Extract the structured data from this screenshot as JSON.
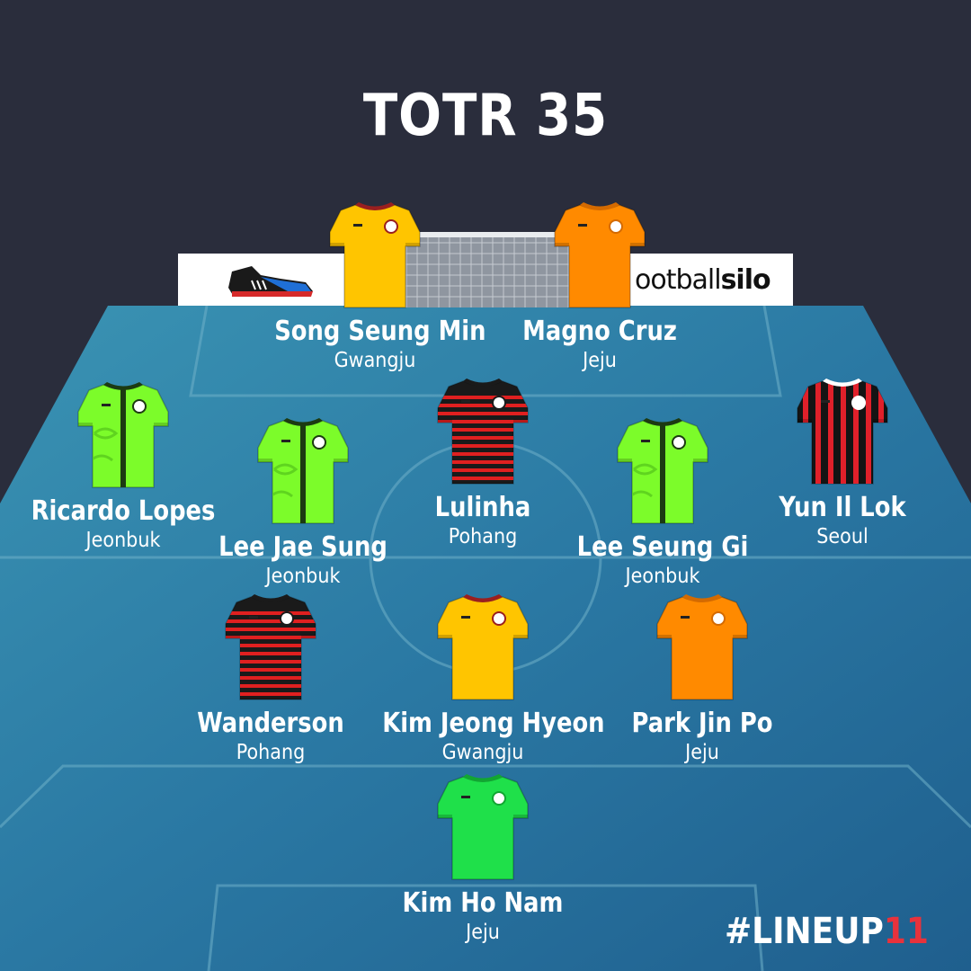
{
  "title": "TOTR 35",
  "sponsor": {
    "text_a": "ootball",
    "text_b": "silo"
  },
  "hashtag": {
    "main": "#LINEUP",
    "number": "11"
  },
  "kits": {
    "gwangju": {
      "base": "#ffc500",
      "trim": "#e8a200",
      "collar": "#9a1f1f"
    },
    "jeju": {
      "base": "#ff8a00",
      "trim": "#f07a00",
      "collar": "#d46a00"
    },
    "jeonbuk": {
      "base": "#7cfc2a",
      "trim": "#1c3a12",
      "collar": "#1c3a12"
    },
    "pohang": {
      "base": "#1a1a1a",
      "trim": "#e02020",
      "collar": "#1a1a1a"
    },
    "seoul": {
      "base": "#141414",
      "trim": "#e0202a",
      "collar": "#ffffff"
    },
    "jeju_gk": {
      "base": "#1fe04a",
      "trim": "#18c63e",
      "collar": "#12a632"
    }
  },
  "players": [
    {
      "name": "Song Seung Min",
      "team": "Gwangju",
      "kit": "gwangju"
    },
    {
      "name": "Magno Cruz",
      "team": "Jeju",
      "kit": "jeju"
    },
    {
      "name": "Ricardo Lopes",
      "team": "Jeonbuk",
      "kit": "jeonbuk"
    },
    {
      "name": "Lee Jae Sung",
      "team": "Jeonbuk",
      "kit": "jeonbuk"
    },
    {
      "name": "Lulinha",
      "team": "Pohang",
      "kit": "pohang"
    },
    {
      "name": "Lee Seung Gi",
      "team": "Jeonbuk",
      "kit": "jeonbuk"
    },
    {
      "name": "Yun Il Lok",
      "team": "Seoul",
      "kit": "seoul"
    },
    {
      "name": "Wanderson",
      "team": "Pohang",
      "kit": "pohang"
    },
    {
      "name": "Kim Jeong Hyeon",
      "team": "Gwangju",
      "kit": "gwangju"
    },
    {
      "name": "Park Jin Po",
      "team": "Jeju",
      "kit": "jeju"
    },
    {
      "name": "Kim Ho Nam",
      "team": "Jeju",
      "kit": "jeju_gk"
    }
  ]
}
